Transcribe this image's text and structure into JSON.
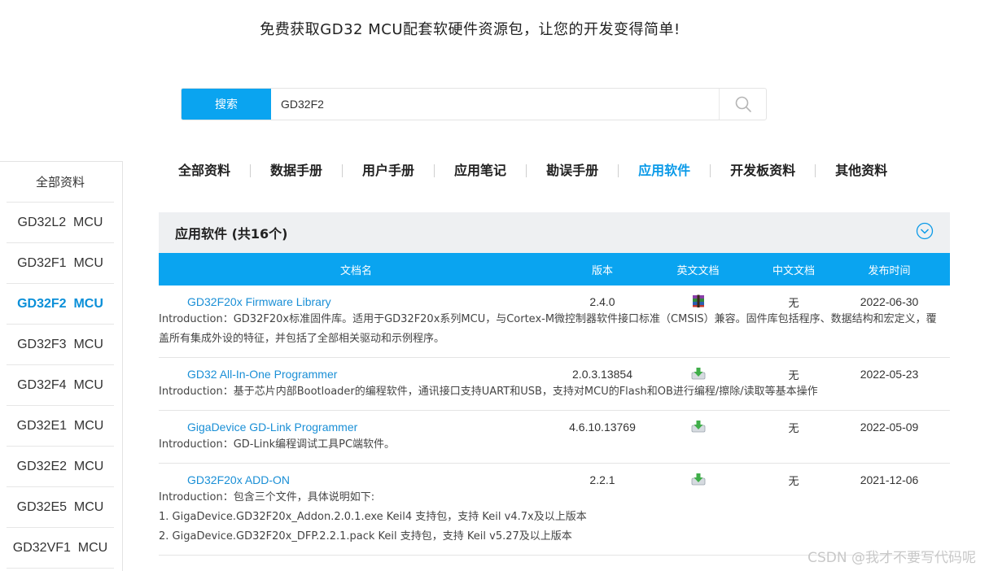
{
  "headline": "免费获取GD32 MCU配套软硬件资源包，让您的开发变得简单!",
  "search": {
    "button_label": "搜索",
    "value": "GD32F2"
  },
  "sidebar": {
    "items": [
      {
        "label": "全部资料"
      },
      {
        "label": "GD32L2  MCU"
      },
      {
        "label": "GD32F1  MCU"
      },
      {
        "label": "GD32F2  MCU"
      },
      {
        "label": "GD32F3  MCU"
      },
      {
        "label": "GD32F4  MCU"
      },
      {
        "label": "GD32E1  MCU"
      },
      {
        "label": "GD32E2  MCU"
      },
      {
        "label": "GD32E5  MCU"
      },
      {
        "label": "GD32VF1  MCU"
      }
    ],
    "active_index": 3
  },
  "tabs": {
    "items": [
      {
        "label": "全部资料"
      },
      {
        "label": "数据手册"
      },
      {
        "label": "用户手册"
      },
      {
        "label": "应用笔记"
      },
      {
        "label": "勘误手册"
      },
      {
        "label": "应用软件"
      },
      {
        "label": "开发板资料"
      },
      {
        "label": "其他资料"
      }
    ],
    "active_index": 5
  },
  "panel": {
    "title": "应用软件 (共16个)",
    "columns": {
      "name": "文档名",
      "version": "版本",
      "en_doc": "英文文档",
      "cn_doc": "中文文档",
      "date": "发布时间"
    },
    "rows": [
      {
        "name": "GD32F20x Firmware Library",
        "version": "2.4.0",
        "en_icon": "winrar-archive-icon",
        "cn": "无",
        "date": "2022-06-30",
        "intro": [
          "Introduction：GD32F20x标准固件库。适用于GD32F20x系列MCU，与Cortex-M微控制器软件接口标准（CMSIS）兼容。固件库包括程序、数据结构和宏定义，覆盖所有集成外设的特征，并包括了全部相关驱动和示例程序。"
        ]
      },
      {
        "name": "GD32 All-In-One Programmer",
        "version": "2.0.3.13854",
        "en_icon": "download-icon",
        "cn": "无",
        "date": "2022-05-23",
        "intro": [
          "Introduction：基于芯片内部Bootloader的编程软件，通讯接口支持UART和USB，支持对MCU的Flash和OB进行编程/擦除/读取等基本操作"
        ]
      },
      {
        "name": "GigaDevice GD-Link Programmer",
        "version": "4.6.10.13769",
        "en_icon": "download-icon",
        "cn": "无",
        "date": "2022-05-09",
        "intro": [
          "Introduction：GD-Link编程调试工具PC端软件。"
        ]
      },
      {
        "name": "GD32F20x ADD-ON",
        "version": "2.2.1",
        "en_icon": "download-icon",
        "cn": "无",
        "date": "2021-12-06",
        "intro": [
          "Introduction：包含三个文件，具体说明如下:",
          "1. GigaDevice.GD32F20x_Addon.2.0.1.exe Keil4 支持包，支持 Keil v4.7x及以上版本",
          "2. GigaDevice.GD32F20x_DFP.2.2.1.pack Keil 支持包，支持 Keil v5.27及以上版本"
        ]
      }
    ]
  },
  "watermark": "CSDN @我才不要写代码呢"
}
